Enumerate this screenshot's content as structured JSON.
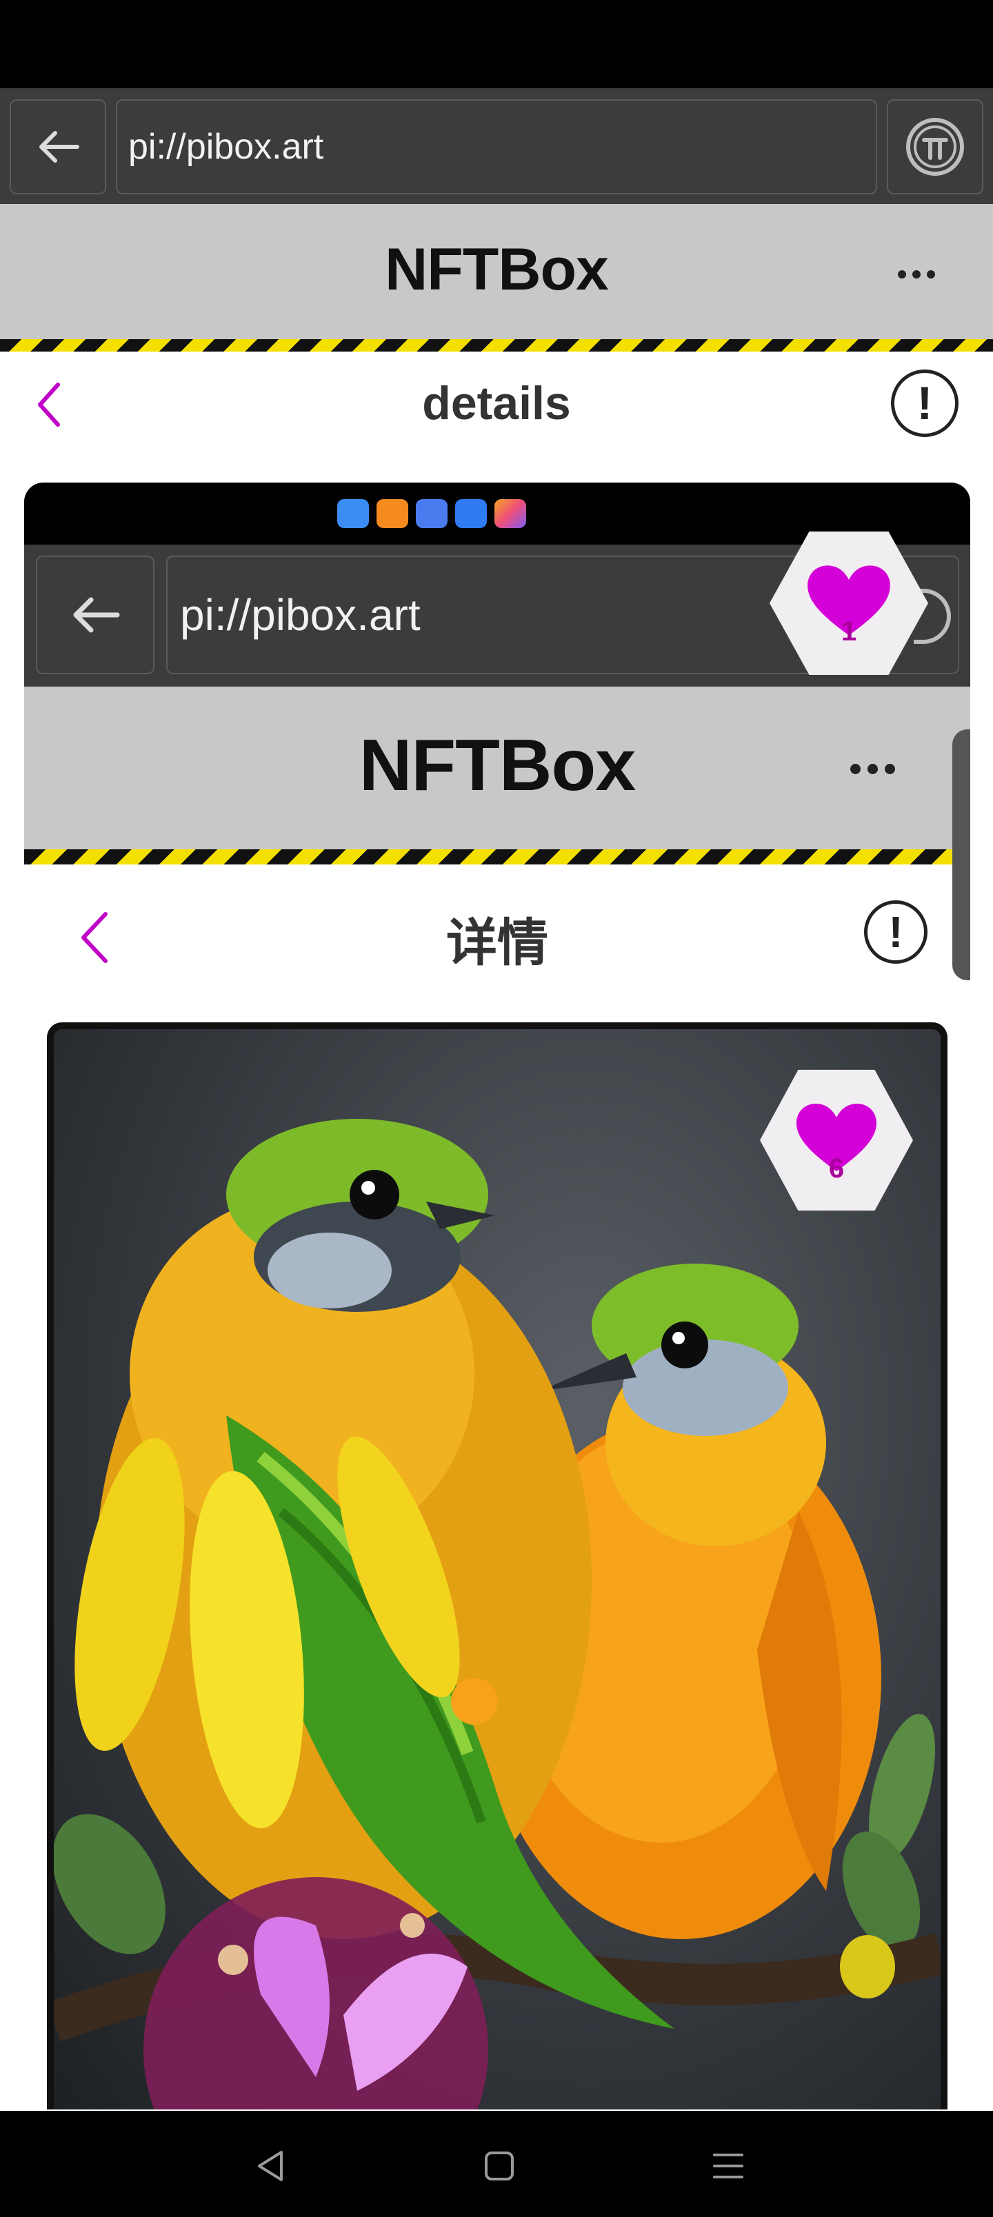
{
  "browser": {
    "url": "pi://pibox.art"
  },
  "app": {
    "title": "NFTBox"
  },
  "page": {
    "title": "details"
  },
  "inner": {
    "browser": {
      "url": "pi://pibox.art"
    },
    "app": {
      "title": "NFTBox"
    },
    "page": {
      "title": "详情"
    },
    "like_badge_top": {
      "count": "1"
    },
    "like_badge_image": {
      "count": "6"
    }
  },
  "colors": {
    "accent": "#c000c8",
    "stripe_yellow": "#f4e000",
    "header_gray": "#c8c8c8"
  }
}
